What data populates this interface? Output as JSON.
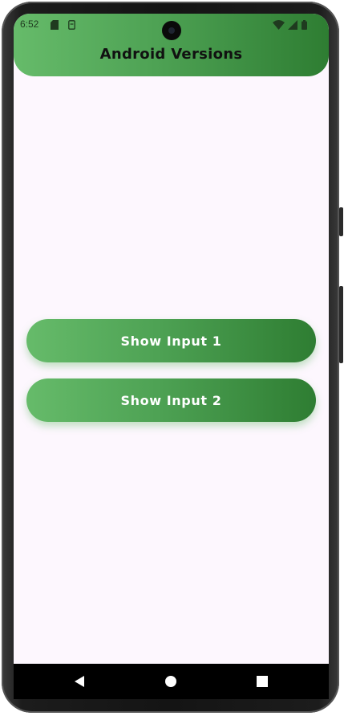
{
  "status_bar": {
    "time": "6:52",
    "icons": [
      "sd-card-icon",
      "sim-icon",
      "wifi-icon",
      "signal-icon",
      "battery-icon"
    ]
  },
  "app_bar": {
    "title": "Android Versions"
  },
  "buttons": {
    "show_input_1": "Show Input 1",
    "show_input_2": "Show Input 2"
  },
  "navigation": {
    "items": [
      "back-icon",
      "home-icon",
      "recents-icon"
    ]
  },
  "colors": {
    "accent_light": "#66bb6a",
    "accent_dark": "#2e7d32",
    "background": "#fdf7fe"
  }
}
